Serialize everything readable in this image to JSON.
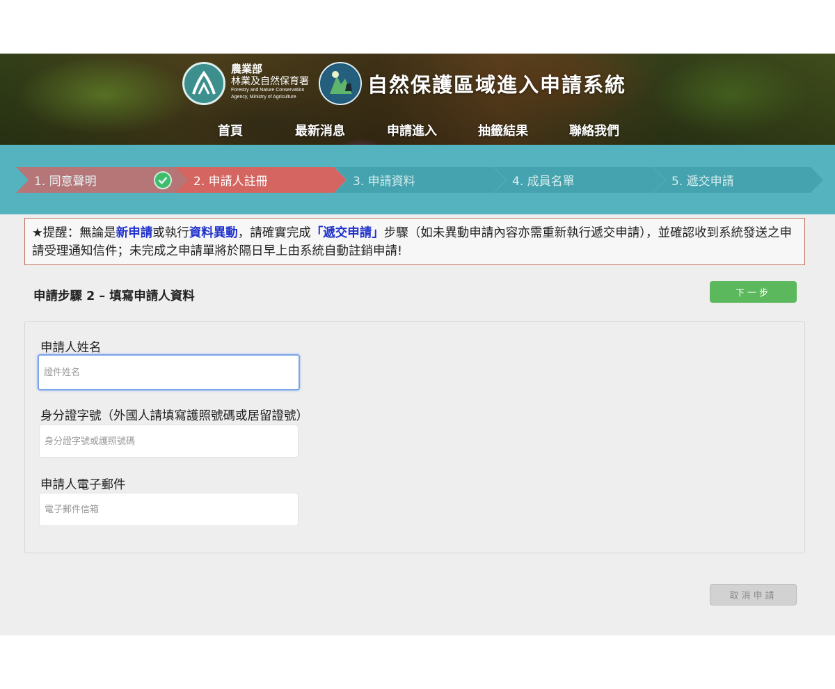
{
  "header": {
    "org_name_line1": "農業部",
    "org_name_line2": "林業及自然保育署",
    "org_name_en_line1": "Forestry and Nature Conservation",
    "org_name_en_line2": "Agency, Ministry of Agriculture",
    "site_title": "自然保護區域進入申請系統",
    "nav": [
      "首頁",
      "最新消息",
      "申請進入",
      "抽籤結果",
      "聯絡我們"
    ]
  },
  "steps": [
    {
      "label": "1. 同意聲明",
      "state": "done"
    },
    {
      "label": "2. 申請人註冊",
      "state": "active"
    },
    {
      "label": "3. 申請資料",
      "state": "todo"
    },
    {
      "label": "4. 成員名單",
      "state": "todo"
    },
    {
      "label": "5. 遞交申請",
      "state": "todo"
    }
  ],
  "notice": {
    "prefix": "★提醒：無論是",
    "hl1": "新申請",
    "mid1": "或執行",
    "hl2": "資料異動",
    "mid2": "，請確實完成",
    "hl3": "「遞交申請」",
    "suffix": "步驟（如未異動申請內容亦需重新執行遞交申請），並確認收到系統發送之申請受理通知信件；未完成之申請單將於隔日早上由系統自動註銷申請!"
  },
  "section_title": "申請步驟 2 – 填寫申請人資料",
  "next_button": "下一步",
  "cancel_button": "取消申請",
  "form": {
    "name_label": "申請人姓名",
    "name_placeholder": "證件姓名",
    "name_value": "",
    "id_label": "身分證字號（外國人請填寫護照號碼或居留證號）",
    "id_placeholder": "身分證字號或護照號碼",
    "id_value": "",
    "email_label": "申請人電子郵件",
    "email_placeholder": "電子郵件信箱",
    "email_value": ""
  },
  "colors": {
    "steps_bar": "#55b3c0",
    "step_active": "#d46560",
    "step_done": "#c86a6a",
    "step_todo": "#44a3ae",
    "next_button": "#5cb85c",
    "notice_highlight": "#2233cc",
    "notice_border": "#c0705a"
  }
}
